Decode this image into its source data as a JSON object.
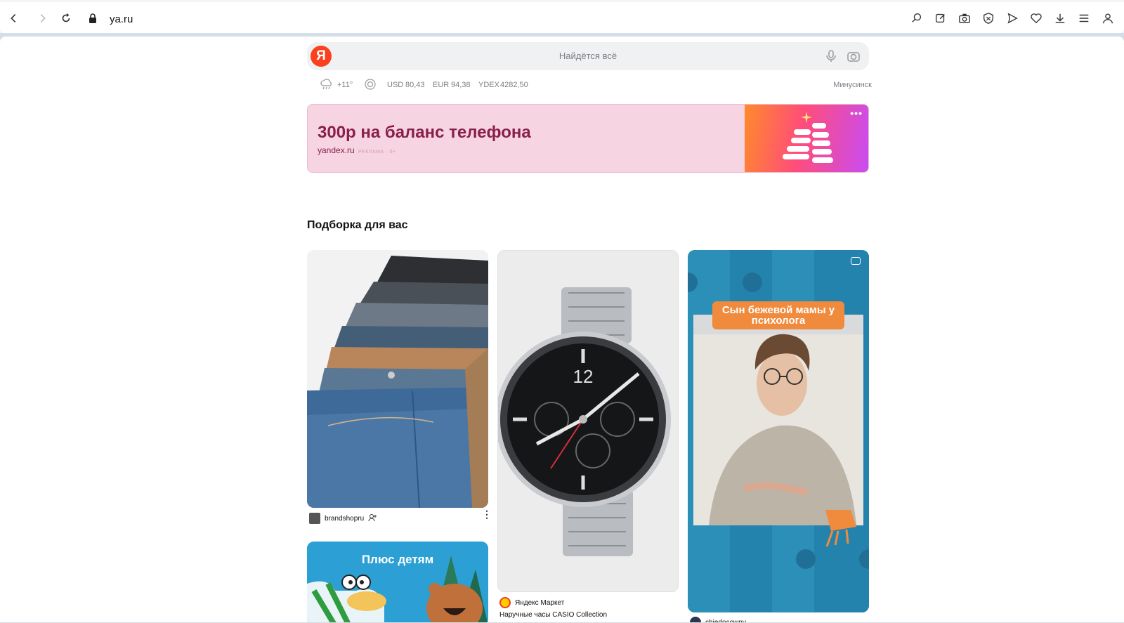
{
  "browser": {
    "url": "ya.ru"
  },
  "search": {
    "logo_letter": "Я",
    "placeholder": "Найдётся всё"
  },
  "infobar": {
    "weather": "+11°",
    "usd_label": "USD",
    "usd_value": "80,43",
    "eur_label": "EUR",
    "eur_value": "94,38",
    "ydex_label": "YDEX",
    "ydex_value": "4282,50",
    "city": "Минусинск"
  },
  "banner": {
    "title": "300р на баланс телефона",
    "domain": "yandex.ru",
    "ad_label": "РЕКЛАМА · 0+",
    "background": "#f6d4e2",
    "title_color": "#8a1f4a"
  },
  "feed": {
    "title": "Подборка для вас",
    "cards": [
      {
        "source": "brandshopru"
      },
      {
        "source": "Яндекс Маркет",
        "caption": "Наручные часы CASIO Collection"
      },
      {
        "overlay_text": "Сын бежевой мамы у психолога",
        "source": "chiedocowny"
      },
      {
        "overlay_text": "Плюс детям"
      }
    ]
  },
  "colors": {
    "yandex_red": "#fc3f1d",
    "video_card_bg": "#2b8fb8",
    "caption_orange": "#f08a3c"
  }
}
